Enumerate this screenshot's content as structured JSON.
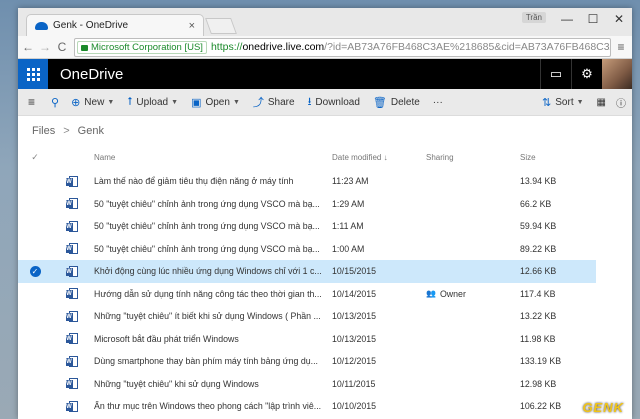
{
  "browser": {
    "tab_title": "Genk - OneDrive",
    "tab_close": "×",
    "user_badge": "Trần",
    "window_controls": [
      "—",
      "☐",
      "✕"
    ],
    "nav": {
      "back": "←",
      "forward": "→",
      "reload": "C"
    },
    "secure_label": "Microsoft Corporation [US]",
    "url_scheme": "https://",
    "url_host": "onedrive.live.com",
    "url_path": "/?id=AB73A76FB468C3AE%218685&cid=AB73A76FB468C3AE",
    "menu": "≡"
  },
  "app": {
    "name": "OneDrive",
    "header_icons": [
      "chat-icon",
      "gear-icon"
    ]
  },
  "commands": {
    "search": "⚲",
    "new": "New",
    "upload": "Upload",
    "open": "Open",
    "share": "Share",
    "download": "Download",
    "delete": "Delete",
    "more": "···",
    "sort": "Sort",
    "view": "▦",
    "info": "ⓘ"
  },
  "breadcrumb": {
    "root": "Files",
    "separator": ">",
    "current": "Genk"
  },
  "table": {
    "headers": {
      "name": "Name",
      "date": "Date modified ↓",
      "sharing": "Sharing",
      "size": "Size",
      "check": "✓"
    },
    "rows": [
      {
        "name": "Làm thế nào để giảm tiêu thụ điện năng ở máy tính",
        "date": "11:23 AM",
        "sharing": "",
        "size": "13.94 KB",
        "selected": false
      },
      {
        "name": "50 \"tuyệt chiêu\" chỉnh ảnh trong ứng dụng VSCO mà bạ...",
        "date": "1:29 AM",
        "sharing": "",
        "size": "66.2 KB",
        "selected": false
      },
      {
        "name": "50 \"tuyệt chiêu\" chỉnh ảnh trong ứng dụng VSCO mà bạ...",
        "date": "1:11 AM",
        "sharing": "",
        "size": "59.94 KB",
        "selected": false
      },
      {
        "name": "50 \"tuyệt chiêu\" chỉnh ảnh trong ứng dụng VSCO mà bạ...",
        "date": "1:00 AM",
        "sharing": "",
        "size": "89.22 KB",
        "selected": false
      },
      {
        "name": "Khởi động cùng lúc nhiều ứng dụng Windows chỉ với 1 c...",
        "date": "10/15/2015",
        "sharing": "",
        "size": "12.66 KB",
        "selected": true
      },
      {
        "name": "Hướng dẫn sử dụng tính năng công tác theo thời gian th...",
        "date": "10/14/2015",
        "sharing": "Owner",
        "size": "117.4 KB",
        "selected": false
      },
      {
        "name": "Những \"tuyệt chiêu\" ít biết khi sử dụng Windows ( Phần ...",
        "date": "10/13/2015",
        "sharing": "",
        "size": "13.22 KB",
        "selected": false
      },
      {
        "name": "Microsoft bắt đầu phát triển Windows",
        "date": "10/13/2015",
        "sharing": "",
        "size": "11.98 KB",
        "selected": false
      },
      {
        "name": "Dùng smartphone thay bàn phím máy tính bảng ứng dụ...",
        "date": "10/12/2015",
        "sharing": "",
        "size": "133.19 KB",
        "selected": false
      },
      {
        "name": "Những \"tuyệt chiêu\" khi sử dụng Windows",
        "date": "10/11/2015",
        "sharing": "",
        "size": "12.98 KB",
        "selected": false
      },
      {
        "name": "Ẩn thư mục trên Windows theo phong cách \"lập trình viê...",
        "date": "10/10/2015",
        "sharing": "",
        "size": "106.22 KB",
        "selected": false
      }
    ]
  },
  "watermark": "GENK",
  "colors": {
    "accent": "#0a64c6",
    "selected_row": "#cde8fb",
    "appbar": "#000000"
  }
}
